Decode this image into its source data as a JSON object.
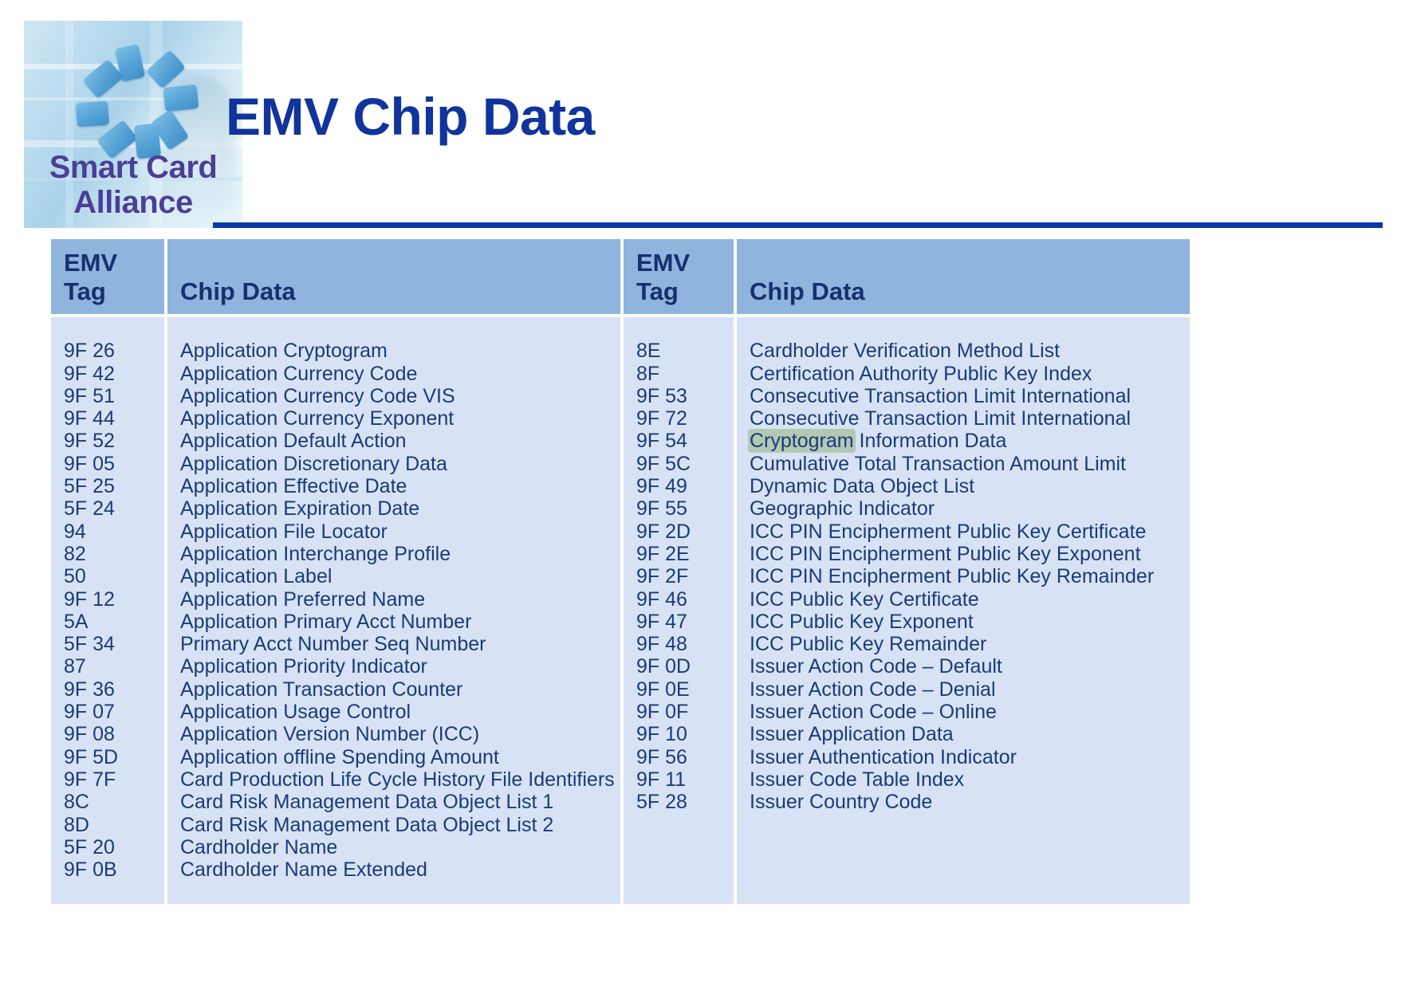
{
  "slide": {
    "title": "EMV Chip Data",
    "title_color": "#10349b",
    "rule_color": "#0b37a8",
    "background": "#ffffff"
  },
  "logo": {
    "name": "smart-card-alliance-logo",
    "wordmark_line1": "Smart Card",
    "wordmark_line2": "Alliance",
    "wordmark_color": "#4a3f96",
    "chip_color": "#56a2d6"
  },
  "table": {
    "header_bg": "#8fb4de",
    "body_bg": "#d7e3f4",
    "text_color": "#1b3a79",
    "header_text_color": "#16306e",
    "highlight_color": "#b2cab4",
    "columns": [
      {
        "tag_header_line1": "EMV",
        "tag_header_line2": "Tag",
        "data_header": "Chip Data"
      },
      {
        "tag_header_line1": "EMV",
        "tag_header_line2": "Tag",
        "data_header": "Chip Data"
      }
    ],
    "left_rows": [
      {
        "tag": "9F 26",
        "data": "Application Cryptogram"
      },
      {
        "tag": "9F 42",
        "data": "Application Currency Code"
      },
      {
        "tag": "9F 51",
        "data": "Application Currency Code VIS"
      },
      {
        "tag": "9F 44",
        "data": "Application Currency Exponent"
      },
      {
        "tag": "9F 52",
        "data": "Application Default Action"
      },
      {
        "tag": "9F 05",
        "data": "Application Discretionary Data"
      },
      {
        "tag": "5F 25",
        "data": "Application Effective Date"
      },
      {
        "tag": "5F 24",
        "data": "Application Expiration Date"
      },
      {
        "tag": "94",
        "data": "Application File Locator"
      },
      {
        "tag": "82",
        "data": "Application Interchange Profile"
      },
      {
        "tag": "50",
        "data": "Application Label"
      },
      {
        "tag": "9F 12",
        "data": "Application Preferred Name"
      },
      {
        "tag": "5A",
        "data": "Application Primary Acct Number"
      },
      {
        "tag": "5F 34",
        "data": "Primary Acct Number Seq Number"
      },
      {
        "tag": "87",
        "data": "Application Priority Indicator"
      },
      {
        "tag": "9F 36",
        "data": "Application Transaction Counter"
      },
      {
        "tag": "9F 07",
        "data": "Application Usage Control"
      },
      {
        "tag": "9F 08",
        "data": "Application Version Number (ICC)"
      },
      {
        "tag": "9F 5D",
        "data": "Application offline Spending Amount"
      },
      {
        "tag": "9F 7F",
        "data": "Card Production Life Cycle History File Identifiers"
      },
      {
        "tag": "8C",
        "data": "Card Risk Management Data Object List 1"
      },
      {
        "tag": "8D",
        "data": "Card Risk Management Data Object List 2"
      },
      {
        "tag": "5F 20",
        "data": "Cardholder Name"
      },
      {
        "tag": "9F 0B",
        "data": "Cardholder Name Extended"
      }
    ],
    "right_rows": [
      {
        "tag": "8E",
        "data": "Cardholder Verification Method List"
      },
      {
        "tag": "8F",
        "data": "Certification Authority Public Key Index"
      },
      {
        "tag": "9F 53",
        "data": "Consecutive Transaction Limit International"
      },
      {
        "tag": "9F 72",
        "data": "Consecutive Transaction Limit International"
      },
      {
        "tag": "9F 54",
        "data": "Cryptogram Information Data",
        "highlight": "Cryptogram"
      },
      {
        "tag": "9F 5C",
        "data": "Cumulative Total Transaction Amount Limit"
      },
      {
        "tag": "9F 49",
        "data": "Dynamic Data Object List"
      },
      {
        "tag": "9F 55",
        "data": "Geographic Indicator"
      },
      {
        "tag": "9F 2D",
        "data": "ICC PIN Encipherment Public Key Certificate"
      },
      {
        "tag": "9F 2E",
        "data": "ICC PIN Encipherment Public Key Exponent"
      },
      {
        "tag": "9F 2F",
        "data": "ICC PIN Encipherment Public Key Remainder"
      },
      {
        "tag": "9F 46",
        "data": "ICC Public Key Certificate"
      },
      {
        "tag": "9F 47",
        "data": "ICC Public Key Exponent"
      },
      {
        "tag": "9F 48",
        "data": "ICC Public Key Remainder"
      },
      {
        "tag": "9F 0D",
        "data": "Issuer Action Code – Default"
      },
      {
        "tag": "9F 0E",
        "data": "Issuer Action Code – Denial"
      },
      {
        "tag": "9F 0F",
        "data": "Issuer Action Code – Online"
      },
      {
        "tag": "9F 10",
        "data": "Issuer Application Data"
      },
      {
        "tag": "9F 56",
        "data": "Issuer Authentication Indicator"
      },
      {
        "tag": "9F 11",
        "data": "Issuer Code Table Index"
      },
      {
        "tag": "5F 28",
        "data": "Issuer Country Code"
      }
    ]
  }
}
